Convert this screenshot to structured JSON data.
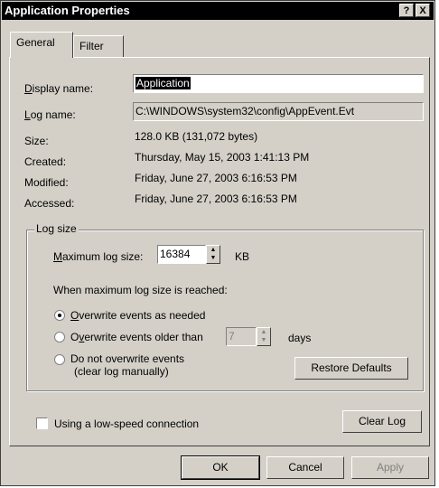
{
  "window": {
    "title": "Application Properties",
    "help_btn": "?",
    "close_btn": "X"
  },
  "tabs": [
    {
      "label": "General"
    },
    {
      "label": "Filter"
    }
  ],
  "general": {
    "display_name_label": "Display name:",
    "display_name_value": "Application",
    "log_name_label": "Log name:",
    "log_name_value": "C:\\WINDOWS\\system32\\config\\AppEvent.Evt",
    "size_label": "Size:",
    "size_value": "128.0 KB (131,072 bytes)",
    "created_label": "Created:",
    "created_value": "Thursday, May 15, 2003 1:41:13 PM",
    "modified_label": "Modified:",
    "modified_value": "Friday, June 27, 2003 6:16:53 PM",
    "accessed_label": "Accessed:",
    "accessed_value": "Friday, June 27, 2003 6:16:53 PM"
  },
  "log_size": {
    "group_title": "Log size",
    "max_label": "Maximum log size:",
    "max_value": "16384",
    "max_unit": "KB",
    "when_label": "When maximum log size is reached:",
    "opt_overwrite_needed": "Overwrite events as needed",
    "opt_overwrite_older": "Overwrite events older than",
    "older_days_value": "7",
    "days_unit": "days",
    "opt_no_overwrite_line1": "Do not overwrite events",
    "opt_no_overwrite_line2": "(clear log manually)",
    "restore_defaults": "Restore Defaults",
    "selected_option": "overwrite_needed"
  },
  "low_speed_label": "Using a low-speed connection",
  "low_speed_checked": false,
  "clear_log": "Clear Log",
  "buttons": {
    "ok": "OK",
    "cancel": "Cancel",
    "apply": "Apply"
  }
}
